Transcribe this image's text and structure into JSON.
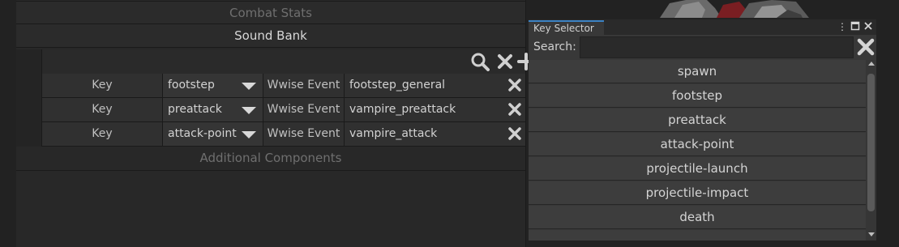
{
  "inspector": {
    "combat_stats": "Combat Stats",
    "sound_bank": "Sound Bank",
    "additional_components": "Additional Components",
    "toolbar_icons": [
      "search-icon",
      "clear-icon",
      "add-icon"
    ],
    "rows": [
      {
        "key_label": "Key",
        "key_value": "footstep",
        "event_label": "Wwise Event",
        "event_value": "footstep_general"
      },
      {
        "key_label": "Key",
        "key_value": "preattack",
        "event_label": "Wwise Event",
        "event_value": "vampire_preattack"
      },
      {
        "key_label": "Key",
        "key_value": "attack-point",
        "event_label": "Wwise Event",
        "event_value": "vampire_attack"
      }
    ]
  },
  "key_selector": {
    "tab_title": "Key Selector",
    "window_icons": [
      "menu-kebab-icon",
      "maximize-icon",
      "close-icon"
    ],
    "search_label": "Search:",
    "search_value": "",
    "items": [
      "spawn",
      "footstep",
      "preattack",
      "attack-point",
      "projectile-launch",
      "projectile-impact",
      "death"
    ],
    "scroll_position": 0.0
  },
  "colors": {
    "accent_tab": "#3b82c4",
    "panel_bg": "#282828",
    "item_bg": "#3d3d3d"
  }
}
